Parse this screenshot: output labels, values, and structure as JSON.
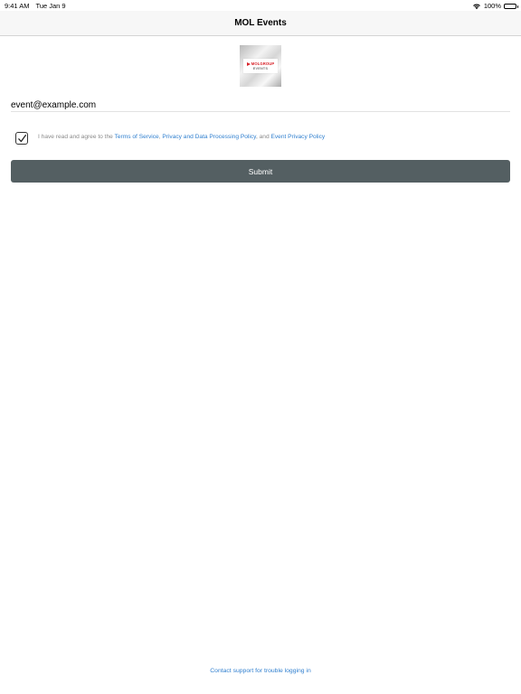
{
  "status_bar": {
    "time": "9:41 AM",
    "date": "Tue Jan 9",
    "battery": "100%",
    "icons": [
      "wifi-icon",
      "battery-icon"
    ]
  },
  "nav": {
    "title": "MOL Events"
  },
  "logo": {
    "brand": "MOLGROUP",
    "sub": "EVENTS",
    "colors": {
      "brand": "#d8232a",
      "sub": "#777777"
    }
  },
  "form": {
    "email_value": "event@example.com",
    "consent": {
      "checked": true,
      "prefix": "I have read and agree to the ",
      "terms_link": "Terms of Service",
      "sep1": ", ",
      "privacy_link": "Privacy and Data Processing Policy",
      "sep2": ", and ",
      "event_privacy_link": "Event Privacy Policy"
    },
    "submit_label": "Submit"
  },
  "footer": {
    "support_link": "Contact support for trouble logging in"
  },
  "colors": {
    "link": "#2f7fcf",
    "submit_bg": "#545f62",
    "nav_bg": "#f7f7f7"
  }
}
